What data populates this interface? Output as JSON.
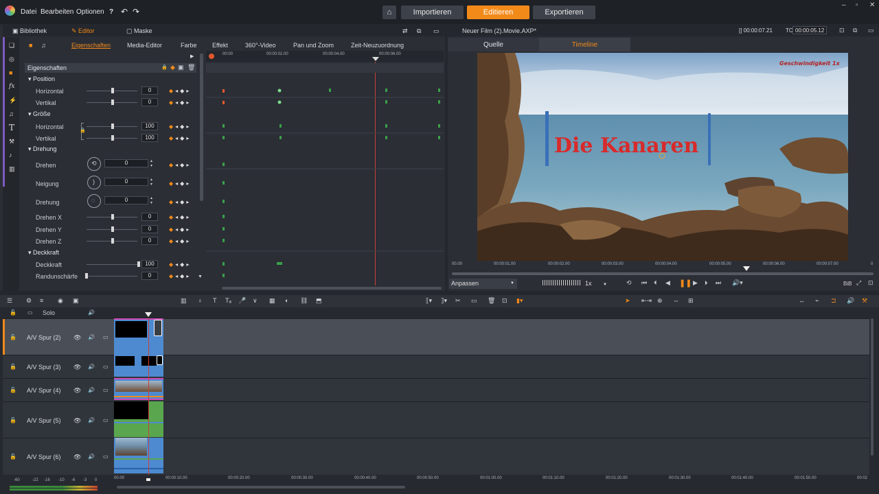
{
  "topbar": {
    "menu": [
      "Datei",
      "Bearbeiten",
      "Optionen"
    ],
    "modes": [
      "Importieren",
      "Editieren",
      "Exportieren"
    ],
    "active_mode": "Editieren"
  },
  "left_panel": {
    "tabs": [
      "Bibliothek",
      "Editor",
      "Maske"
    ],
    "subtabs": [
      "Eigenschaften",
      "Media-Editor",
      "Farbe",
      "Effekt",
      "360°-Video",
      "Pan und Zoom",
      "Zeit-Neuzuordnung"
    ],
    "props_header": "Eigenschaften",
    "timecodes": [
      "00:00",
      "00:00:02.00",
      "00:00:04.00",
      "00:00:06.00"
    ],
    "groups": {
      "position": "Position",
      "groesse": "Größe",
      "drehung": "Drehung",
      "deckkraft": "Deckkraft"
    },
    "rows": {
      "pos_h": {
        "label": "Horizontal",
        "value": "0",
        "level": 0.3
      },
      "pos_v": {
        "label": "Vertikal",
        "value": "0",
        "level": 0.3
      },
      "size_h": {
        "label": "Horizontal",
        "value": "100",
        "level": 0.3
      },
      "size_v": {
        "label": "Vertikal",
        "value": "100",
        "level": 0.3
      },
      "drehen": {
        "label": "Drehen",
        "value": "0"
      },
      "neigung": {
        "label": "Neigung",
        "value": "0"
      },
      "drehung": {
        "label": "Drehung",
        "value": "0"
      },
      "drehx": {
        "label": "Drehen X",
        "value": "0",
        "level": 0.5
      },
      "drehy": {
        "label": "Drehen Y",
        "value": "0",
        "level": 0.5
      },
      "drehz": {
        "label": "Drehen Z",
        "value": "0",
        "level": 0.5
      },
      "deck": {
        "label": "Deckkraft",
        "value": "100",
        "level": 1.0
      },
      "rand": {
        "label": "Randunschärfe",
        "value": "0",
        "level": 0.0
      }
    }
  },
  "right_panel": {
    "title": "Neuer Film (2).Movie.AXP*",
    "tc1": "[] 00:00:07.21",
    "tc2_label": "TC",
    "tc2": "00:00:05.12",
    "tabs": [
      "Quelle",
      "Timeline"
    ],
    "active_tab": "Timeline",
    "preview_title": "Die Kanaren",
    "speed_label": "Geschwindigkeit 1x",
    "scrub_ticks": [
      "00.00",
      "00:00:01.00",
      "00:00:02.00",
      "00:00:03.00",
      "00:00:04.00",
      "00:00:05.00",
      "00:00:06.00",
      "00:00:07.00",
      "0"
    ],
    "fit": "Anpassen",
    "speed": "1x",
    "pip": "BiB"
  },
  "timeline": {
    "solo": "Solo",
    "tracks": [
      "A/V Spur (2)",
      "A/V Spur (3)",
      "A/V Spur (4)",
      "A/V Spur (5)",
      "A/V Spur (6)"
    ],
    "meter_ticks": [
      "-60",
      "-22",
      "-16",
      "-10",
      "-6",
      "-3",
      "0"
    ],
    "ruler": [
      "00.00",
      "00:00:10.00",
      "00:00:20.00",
      "00:00:30.00",
      "00:00:40.00",
      "00:00:50.00",
      "00:01:00.00",
      "00:01:10.00",
      "00:01:20.00",
      "00:01:30.00",
      "00:01:40.00",
      "00:01:50.00",
      "00:02"
    ]
  },
  "colors": {
    "accent": "#f28a1a",
    "bg": "#2b2e35",
    "clip_blue": "#4d8ad0",
    "clip_green": "#5aa64f"
  }
}
